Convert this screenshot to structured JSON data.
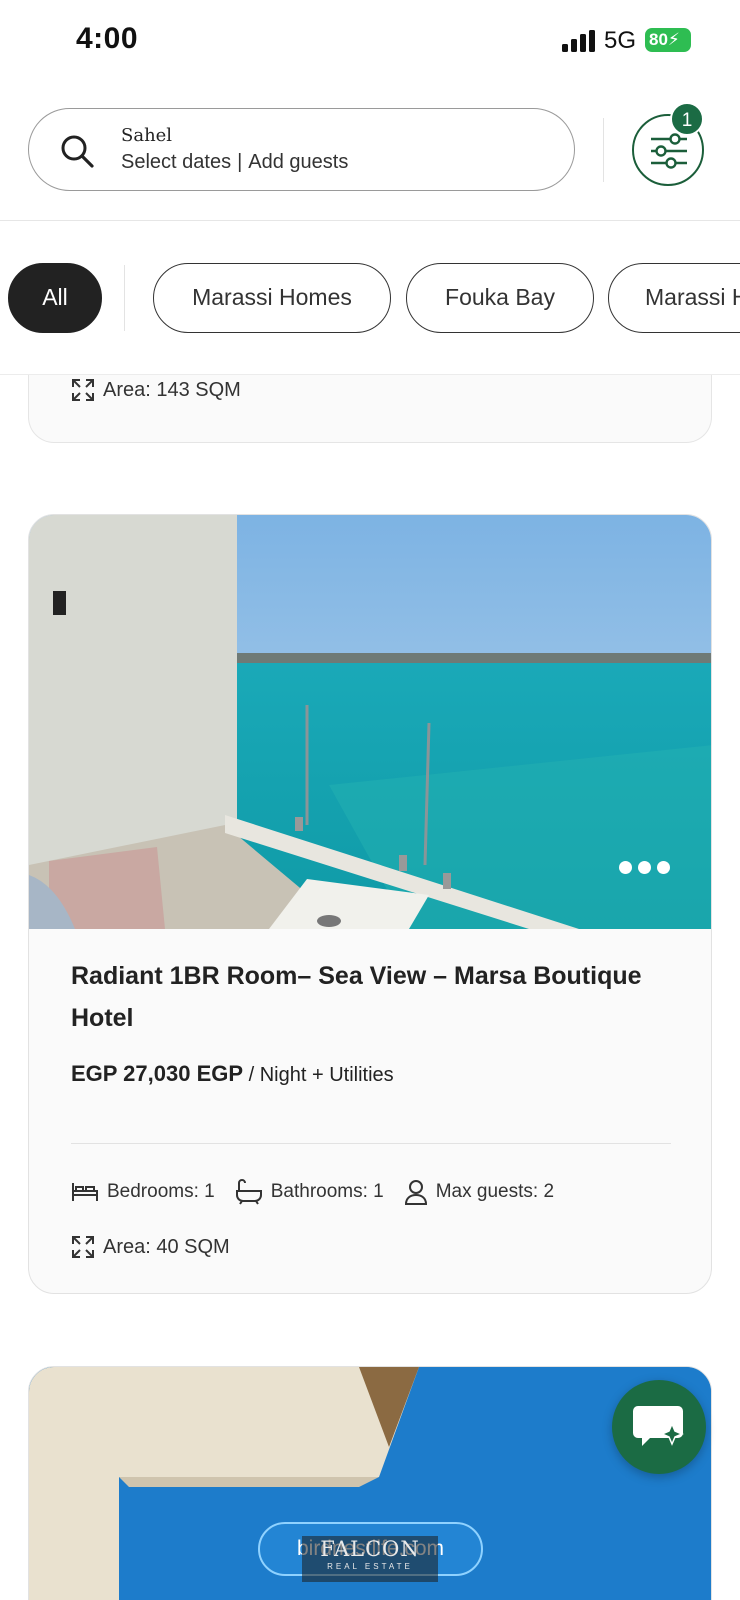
{
  "status_bar": {
    "time": "4:00",
    "network": "5G",
    "battery": "80"
  },
  "search": {
    "location": "Sahel",
    "dates": "Select dates",
    "guests": "Add guests"
  },
  "filters": {
    "badge_count": "1"
  },
  "categories": {
    "items": [
      {
        "label": "All",
        "active": true
      },
      {
        "label": "Marassi Homes",
        "active": false
      },
      {
        "label": "Fouka Bay",
        "active": false
      },
      {
        "label": "Marassi H",
        "active": false
      }
    ]
  },
  "previous_listing": {
    "area": "Area: 143 SQM"
  },
  "listing": {
    "title": "Radiant 1BR Room– Sea View – Marsa Boutique Hotel",
    "price": "EGP 27,030 EGP",
    "price_suffix": "/ Night + Utilities",
    "bedrooms": "Bedrooms: 1",
    "bathrooms": "Bathrooms: 1",
    "max_guests": "Max guests: 2",
    "area": "Area: 40 SQM"
  },
  "next_listing": {
    "url_overlay": "birdnestlife.com"
  },
  "watermark": {
    "brand": "FALCON",
    "sub": "REAL ESTATE"
  },
  "colors": {
    "brand_green": "#1b6b44",
    "chip_active": "#222222",
    "battery": "#2ebd52"
  },
  "icons": [
    "search-icon",
    "filter-icon",
    "area-icon",
    "bed-icon",
    "bathtub-icon",
    "user-icon",
    "chat-sparkle-icon",
    "more-dots-icon"
  ]
}
